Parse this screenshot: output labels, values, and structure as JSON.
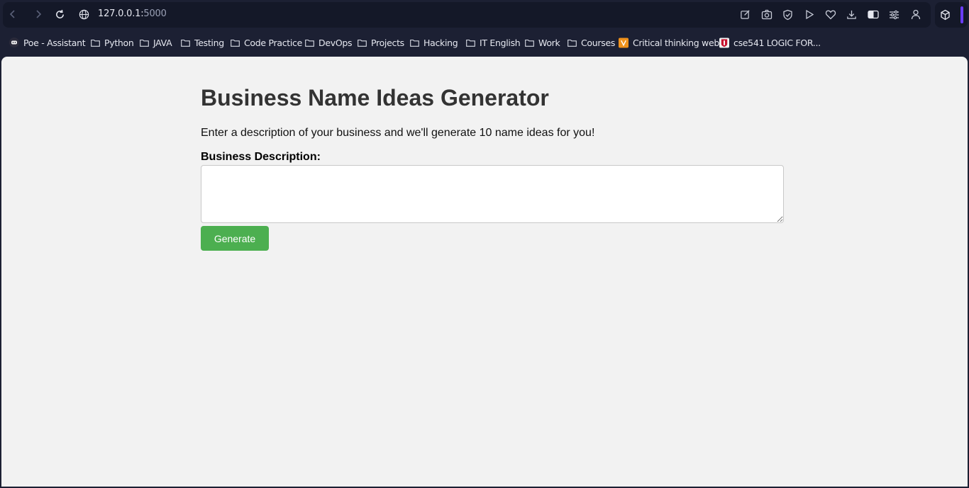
{
  "browser": {
    "url_host": "127.0.0.1:",
    "url_port": "5000",
    "bookmarks": [
      {
        "label": "Poe - Assistant",
        "icon": "poe-icon"
      },
      {
        "label": "Python",
        "icon": "folder-icon"
      },
      {
        "label": "JAVA",
        "icon": "folder-icon"
      },
      {
        "label": "Testing",
        "icon": "folder-icon"
      },
      {
        "label": "Code Practice",
        "icon": "folder-icon"
      },
      {
        "label": "DevOps",
        "icon": "folder-icon"
      },
      {
        "label": "Projects",
        "icon": "folder-icon"
      },
      {
        "label": "Hacking",
        "icon": "folder-icon"
      },
      {
        "label": "IT English",
        "icon": "folder-icon"
      },
      {
        "label": "Work",
        "icon": "folder-icon"
      },
      {
        "label": "Courses",
        "icon": "folder-icon"
      },
      {
        "label": "Critical thinking web",
        "icon": "site-icon-orange"
      },
      {
        "label": "cse541 LOGIC FOR...",
        "icon": "site-icon-red"
      }
    ],
    "accent_color": "#6a3cff"
  },
  "page": {
    "title": "Business Name Ideas Generator",
    "intro": "Enter a description of your business and we'll generate 10 name ideas for you!",
    "description_label": "Business Description:",
    "description_value": "",
    "generate_label": "Generate",
    "button_color": "#4caf50"
  }
}
